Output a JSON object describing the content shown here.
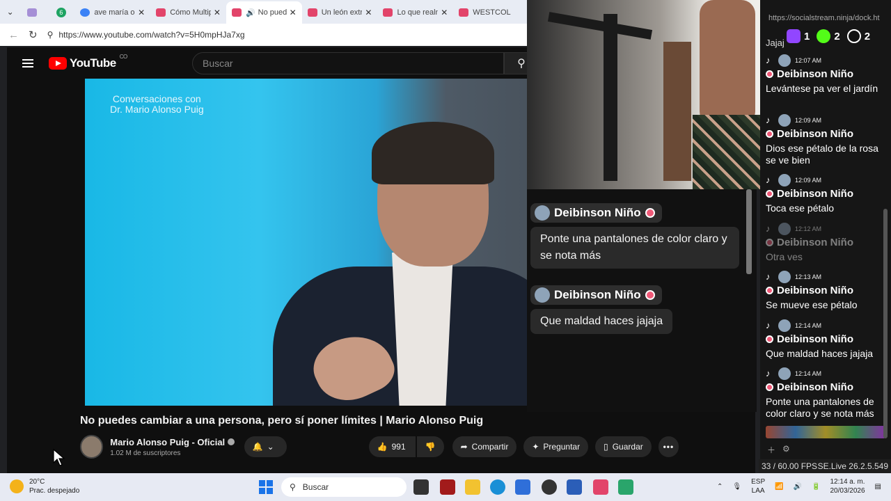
{
  "browser": {
    "tabs": [
      {
        "title": "",
        "icon": "camera-icon"
      },
      {
        "title": "6",
        "icon": "whatsapp-count"
      },
      {
        "title": "ave maría orac",
        "icon": "search-icon"
      },
      {
        "title": "Cómo Multipl",
        "icon": "youtube-icon"
      },
      {
        "title": "No pued",
        "icon": "speaker-icon",
        "active": true
      },
      {
        "title": "Un león extra",
        "icon": "youtube-icon"
      },
      {
        "title": "Lo que realme",
        "icon": "youtube-icon"
      },
      {
        "title": "WESTCOL",
        "icon": "youtube-icon"
      }
    ],
    "url": "https://www.youtube.com/watch?v=5H0mpHJa7xg"
  },
  "youtube": {
    "logo_text": "YouTube",
    "country": "CO",
    "search_placeholder": "Buscar",
    "video_overlay_text": "Conversaciones con\nDr. Mario Alonso Puig",
    "video_title": "No puedes cambiar a una persona, pero sí poner límites | Mario Alonso Puig",
    "channel_name": "Mario Alonso Puig - Oficial",
    "subscribers": "1.02 M de suscriptores",
    "likes": "991",
    "share_label": "Compartir",
    "ask_label": "Preguntar",
    "save_label": "Guardar"
  },
  "overlay_chat": [
    {
      "name": "Deibinson Niño",
      "text": "Ponte una pantalones de color claro y se nota más"
    },
    {
      "name": "Deibinson Niño",
      "text": "Que maldad haces jajaja"
    }
  ],
  "side_chat": {
    "url": "https://socialstream.ninja/dock.ht",
    "counters": {
      "twitch": "1",
      "kick": "2",
      "tiktok": "2"
    },
    "partial_text": "Jajaj",
    "messages": [
      {
        "time": "12:07 AM",
        "name": "Deibinson Niño",
        "text": "Levántese pa ver el jardín"
      },
      {
        "time": "12:09 AM",
        "name": "Deibinson Niño",
        "text": "Dios ese pétalo de la rosa se ve bien"
      },
      {
        "time": "12:09 AM",
        "name": "Deibinson Niño",
        "text": "Toca ese pétalo"
      },
      {
        "time": "12:12 AM",
        "name": "Deibinson Niño",
        "text": "Otra ves",
        "dim": true
      },
      {
        "time": "12:13 AM",
        "name": "Deibinson Niño",
        "text": "Se mueve ese pétalo"
      },
      {
        "time": "12:14 AM",
        "name": "Deibinson Niño",
        "text": "Que maldad haces jajaja"
      },
      {
        "time": "12:14 AM",
        "name": "Deibinson Niño",
        "text": "Ponte una pantalones de color claro y se nota más"
      }
    ],
    "fps": "33 / 60.00 FPS",
    "version": "SE.Live 26.2.5.549"
  },
  "taskbar": {
    "temp": "20°C",
    "weather": "Prac. despejado",
    "search": "Buscar",
    "lang1": "ESP",
    "lang2": "LAA",
    "time": "12:14 a. m.",
    "date": "20/03/2026"
  }
}
